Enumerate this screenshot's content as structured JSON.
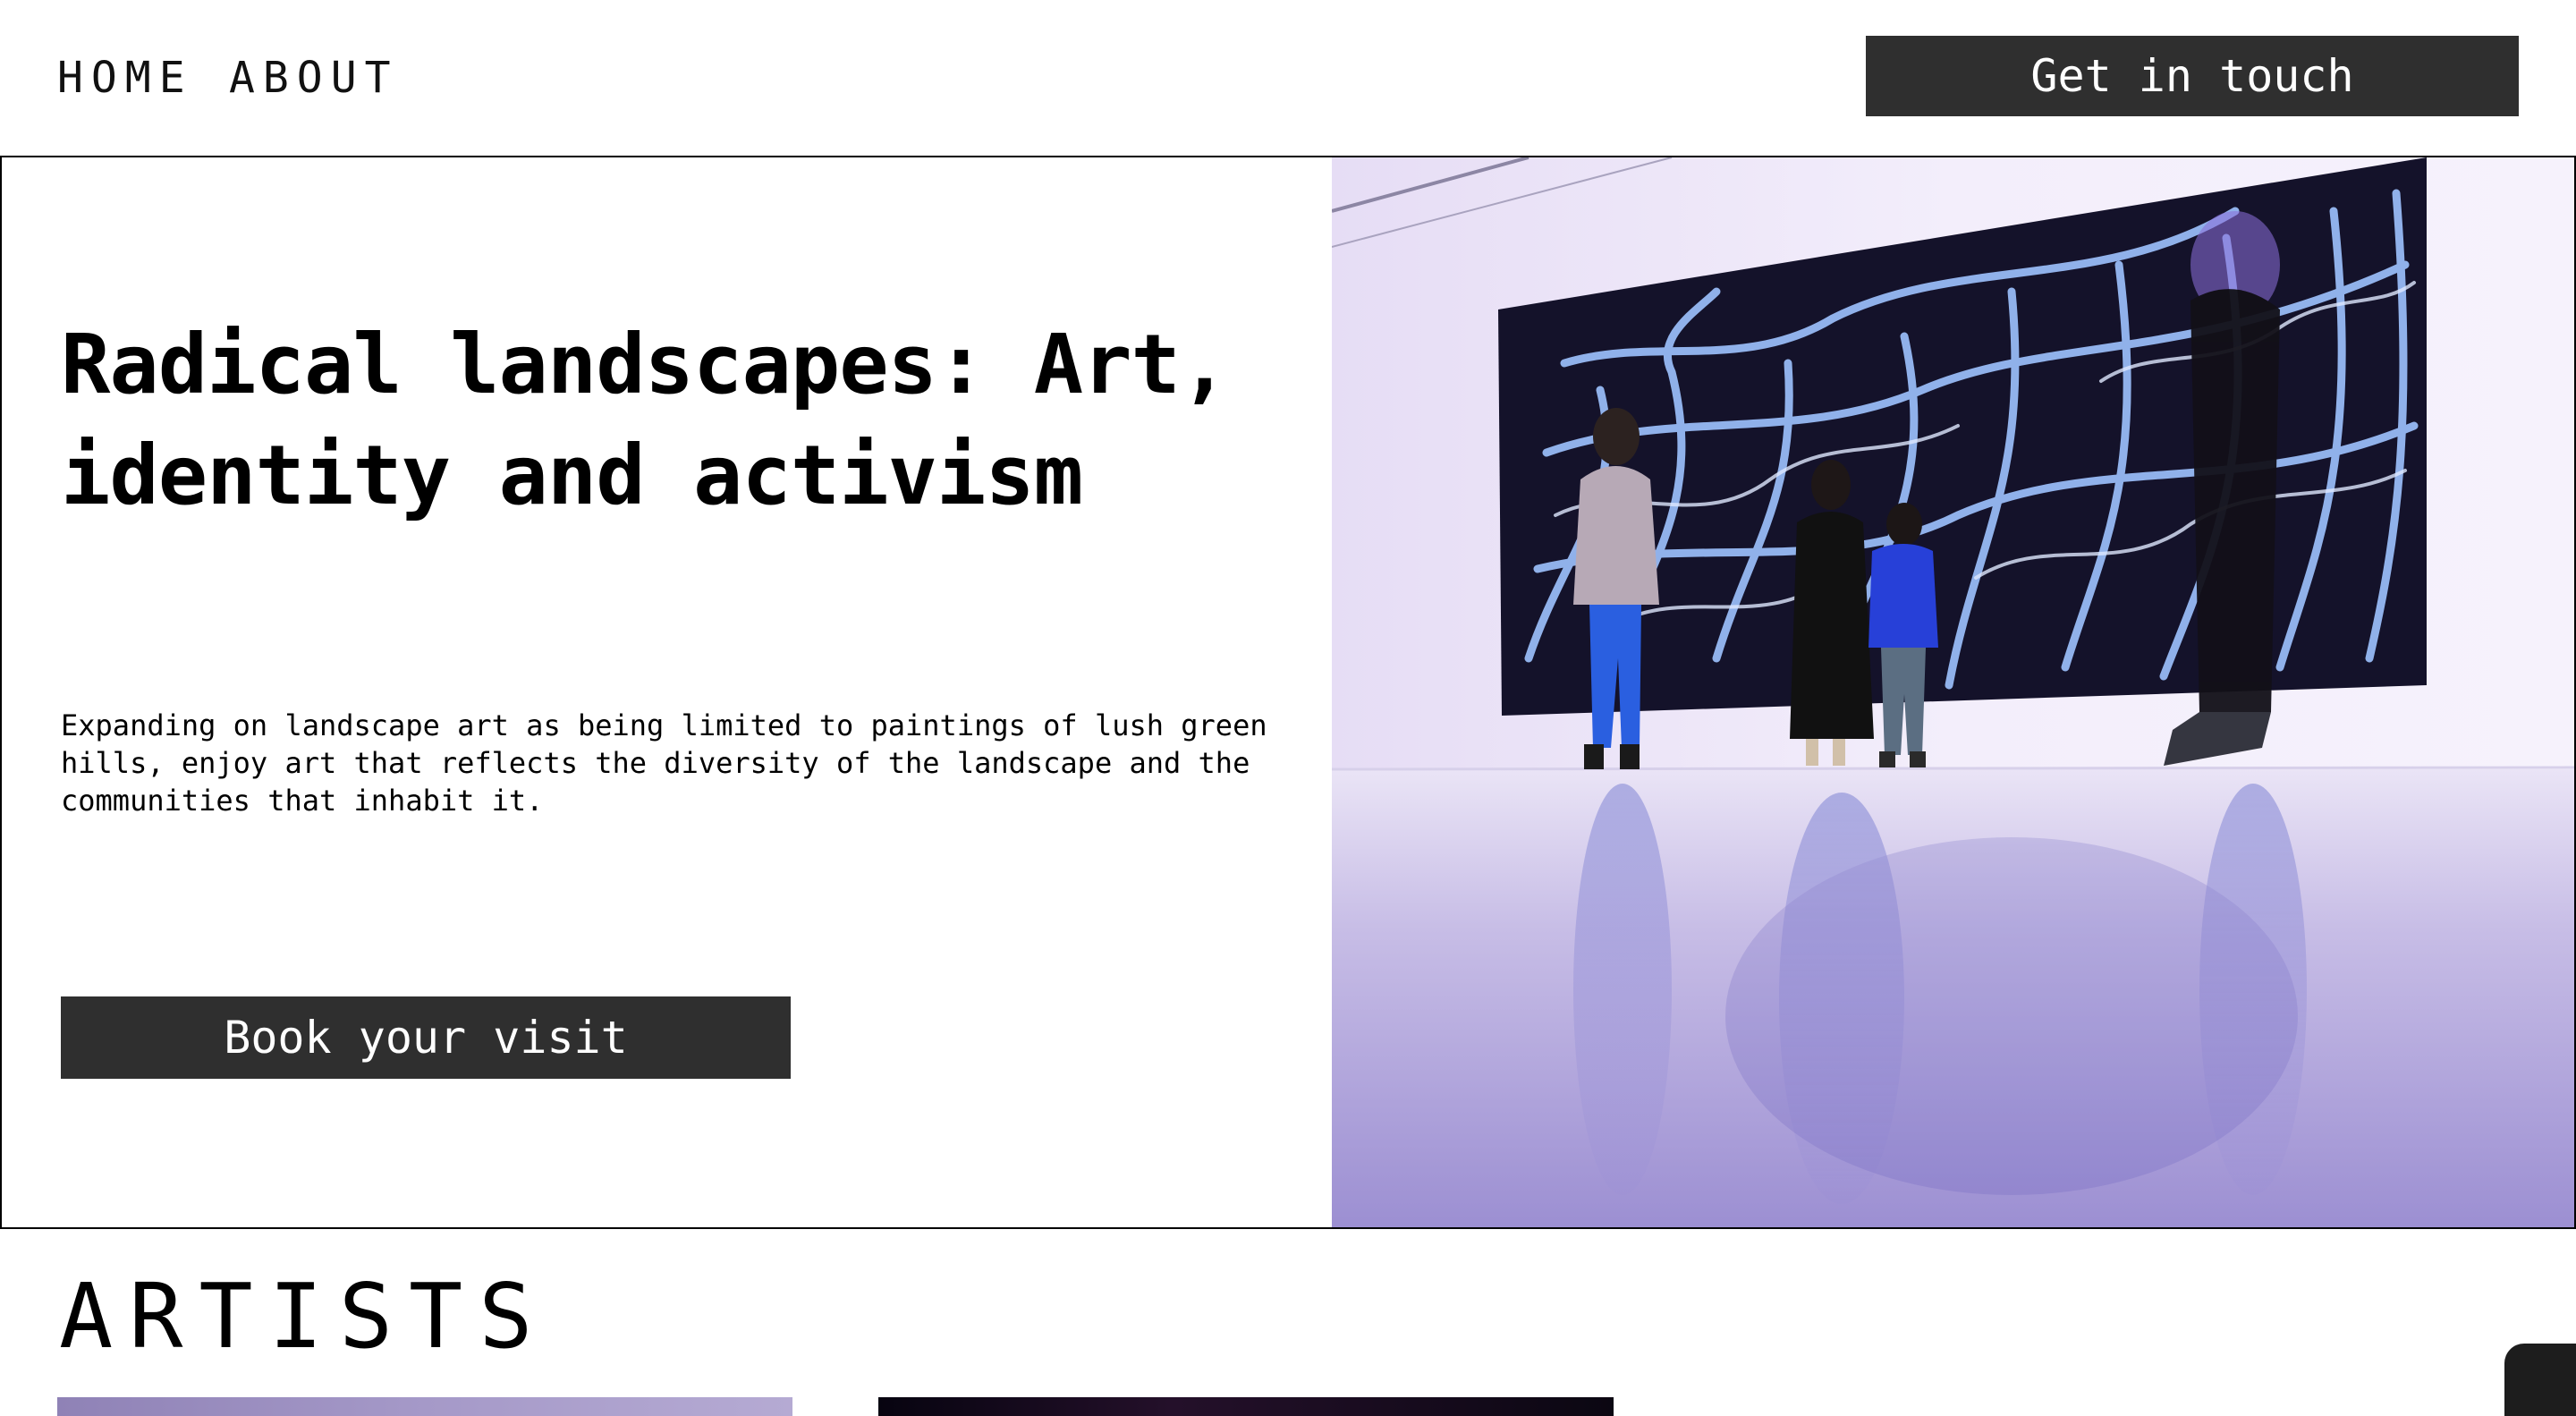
{
  "nav": {
    "links": [
      {
        "label": "HOME"
      },
      {
        "label": "ABOUT"
      }
    ],
    "cta_label": "Get in touch"
  },
  "hero": {
    "title_line1": "Radical landscapes: Art,",
    "title_line2": "identity and activism",
    "description": "Expanding on landscape art as being limited to paintings of lush green hills, enjoy art that reflects the diversity of the landscape and the communities that inhabit it.",
    "button_label": "Book your visit",
    "image_icon": "gallery-photo"
  },
  "artists": {
    "heading": "ARTISTS"
  },
  "colors": {
    "button_bg": "#2f2f2f",
    "text": "#000000",
    "gallery_wall": "#ebe3f7",
    "artwork_bg": "#14122a",
    "artwork_strokes": "#9ec3ff"
  }
}
